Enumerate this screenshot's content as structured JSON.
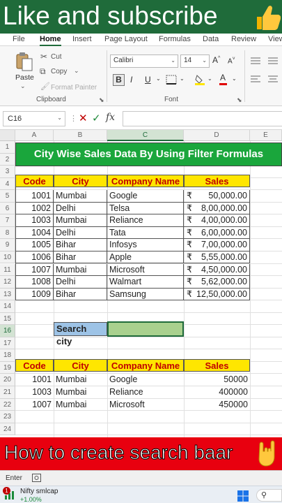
{
  "banner_top": {
    "text": "Like and subscribe",
    "emoji": "thumbs-up-icon"
  },
  "ribbon_tabs": [
    "File",
    "Home",
    "Insert",
    "Page Layout",
    "Formulas",
    "Data",
    "Review",
    "View"
  ],
  "active_tab": "Home",
  "clipboard": {
    "paste": "Paste",
    "cut": "Cut",
    "copy": "Copy",
    "format_painter": "Format Painter",
    "group_label": "Clipboard"
  },
  "font": {
    "family": "Calibri",
    "size": "14",
    "bold": "B",
    "italic": "I",
    "underline": "U",
    "group_label": "Font"
  },
  "name_box": "C16",
  "grid": {
    "columns": [
      "A",
      "B",
      "C",
      "D",
      "E"
    ],
    "rows": [
      "1",
      "2",
      "3",
      "4",
      "5",
      "6",
      "7",
      "8",
      "9",
      "10",
      "11",
      "12",
      "13",
      "14",
      "15",
      "16",
      "17",
      "18",
      "19",
      "20",
      "21",
      "22",
      "23",
      "24"
    ],
    "title": "City Wise Sales Data By Using Filter Formulas",
    "headers": [
      "Code",
      "City",
      "Company Name",
      "Sales"
    ],
    "currency": "₹",
    "data": [
      {
        "code": "1001",
        "city": "Mumbai",
        "company": "Google",
        "sales": "50,000.00"
      },
      {
        "code": "1002",
        "city": "Delhi",
        "company": "Telsa",
        "sales": "8,00,000.00"
      },
      {
        "code": "1003",
        "city": "Mumbai",
        "company": "Reliance",
        "sales": "4,00,000.00"
      },
      {
        "code": "1004",
        "city": "Delhi",
        "company": "Tata",
        "sales": "6,00,000.00"
      },
      {
        "code": "1005",
        "city": "Bihar",
        "company": "Infosys",
        "sales": "7,00,000.00"
      },
      {
        "code": "1006",
        "city": "Bihar",
        "company": "Apple",
        "sales": "5,55,000.00"
      },
      {
        "code": "1007",
        "city": "Mumbai",
        "company": "Microsoft",
        "sales": "4,50,000.00"
      },
      {
        "code": "1008",
        "city": "Delhi",
        "company": "Walmart",
        "sales": "5,62,000.00"
      },
      {
        "code": "1009",
        "city": "Bihar",
        "company": "Samsung",
        "sales": "12,50,000.00"
      }
    ],
    "search_label": "Search city",
    "search_value": "",
    "results": [
      {
        "code": "1001",
        "city": "Mumbai",
        "company": "Google",
        "sales": "50000"
      },
      {
        "code": "1003",
        "city": "Mumbai",
        "company": "Reliance",
        "sales": "400000"
      },
      {
        "code": "1007",
        "city": "Mumbai",
        "company": "Microsoft",
        "sales": "450000"
      }
    ]
  },
  "banner_bottom": {
    "text": "How to create search baar",
    "emoji": "rock-hand-icon"
  },
  "status_bar": {
    "mode": "Enter"
  },
  "taskbar": {
    "widget_title": "Nifty smlcap",
    "widget_value": "+1.00%",
    "badge": "1"
  },
  "colors": {
    "excel_green": "#1f6b3a",
    "title_green": "#1aa63c",
    "header_yellow": "#ffe600",
    "header_red": "#c00000",
    "search_blue": "#9dc3e6",
    "search_green": "#a9d08e",
    "banner_red": "#e8000f"
  }
}
